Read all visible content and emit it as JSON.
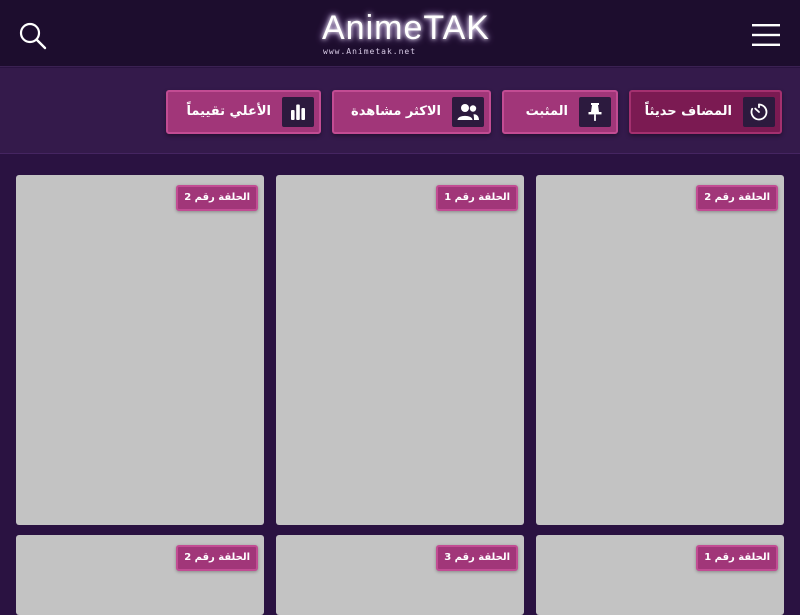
{
  "header": {
    "logo_text": "AnimeTAK",
    "logo_subtext": "www.Animetak.net",
    "search_icon": "search-icon",
    "menu_icon": "hamburger-menu-icon"
  },
  "filters": [
    {
      "label": "المضاف حديثاً",
      "icon": "timer-icon",
      "active": true
    },
    {
      "label": "المثبت",
      "icon": "pin-icon",
      "active": false
    },
    {
      "label": "الاكثر مشاهدة",
      "icon": "users-icon",
      "active": false
    },
    {
      "label": "الأعلي تقييماً",
      "icon": "bar-chart-icon",
      "active": false
    }
  ],
  "episodes": [
    {
      "badge": "الحلقة رقم 2"
    },
    {
      "badge": "الحلقة رقم 1"
    },
    {
      "badge": "الحلقة رقم 2"
    },
    {
      "badge": "الحلقة رقم 1"
    },
    {
      "badge": "الحلقة رقم 3"
    },
    {
      "badge": "الحلقة رقم 2"
    }
  ],
  "colors": {
    "header_bg": "#1d0d2e",
    "page_bg": "#2a1241",
    "accent": "#a13679",
    "accent_active": "#7b1a52",
    "placeholder": "#c3c3c3"
  }
}
